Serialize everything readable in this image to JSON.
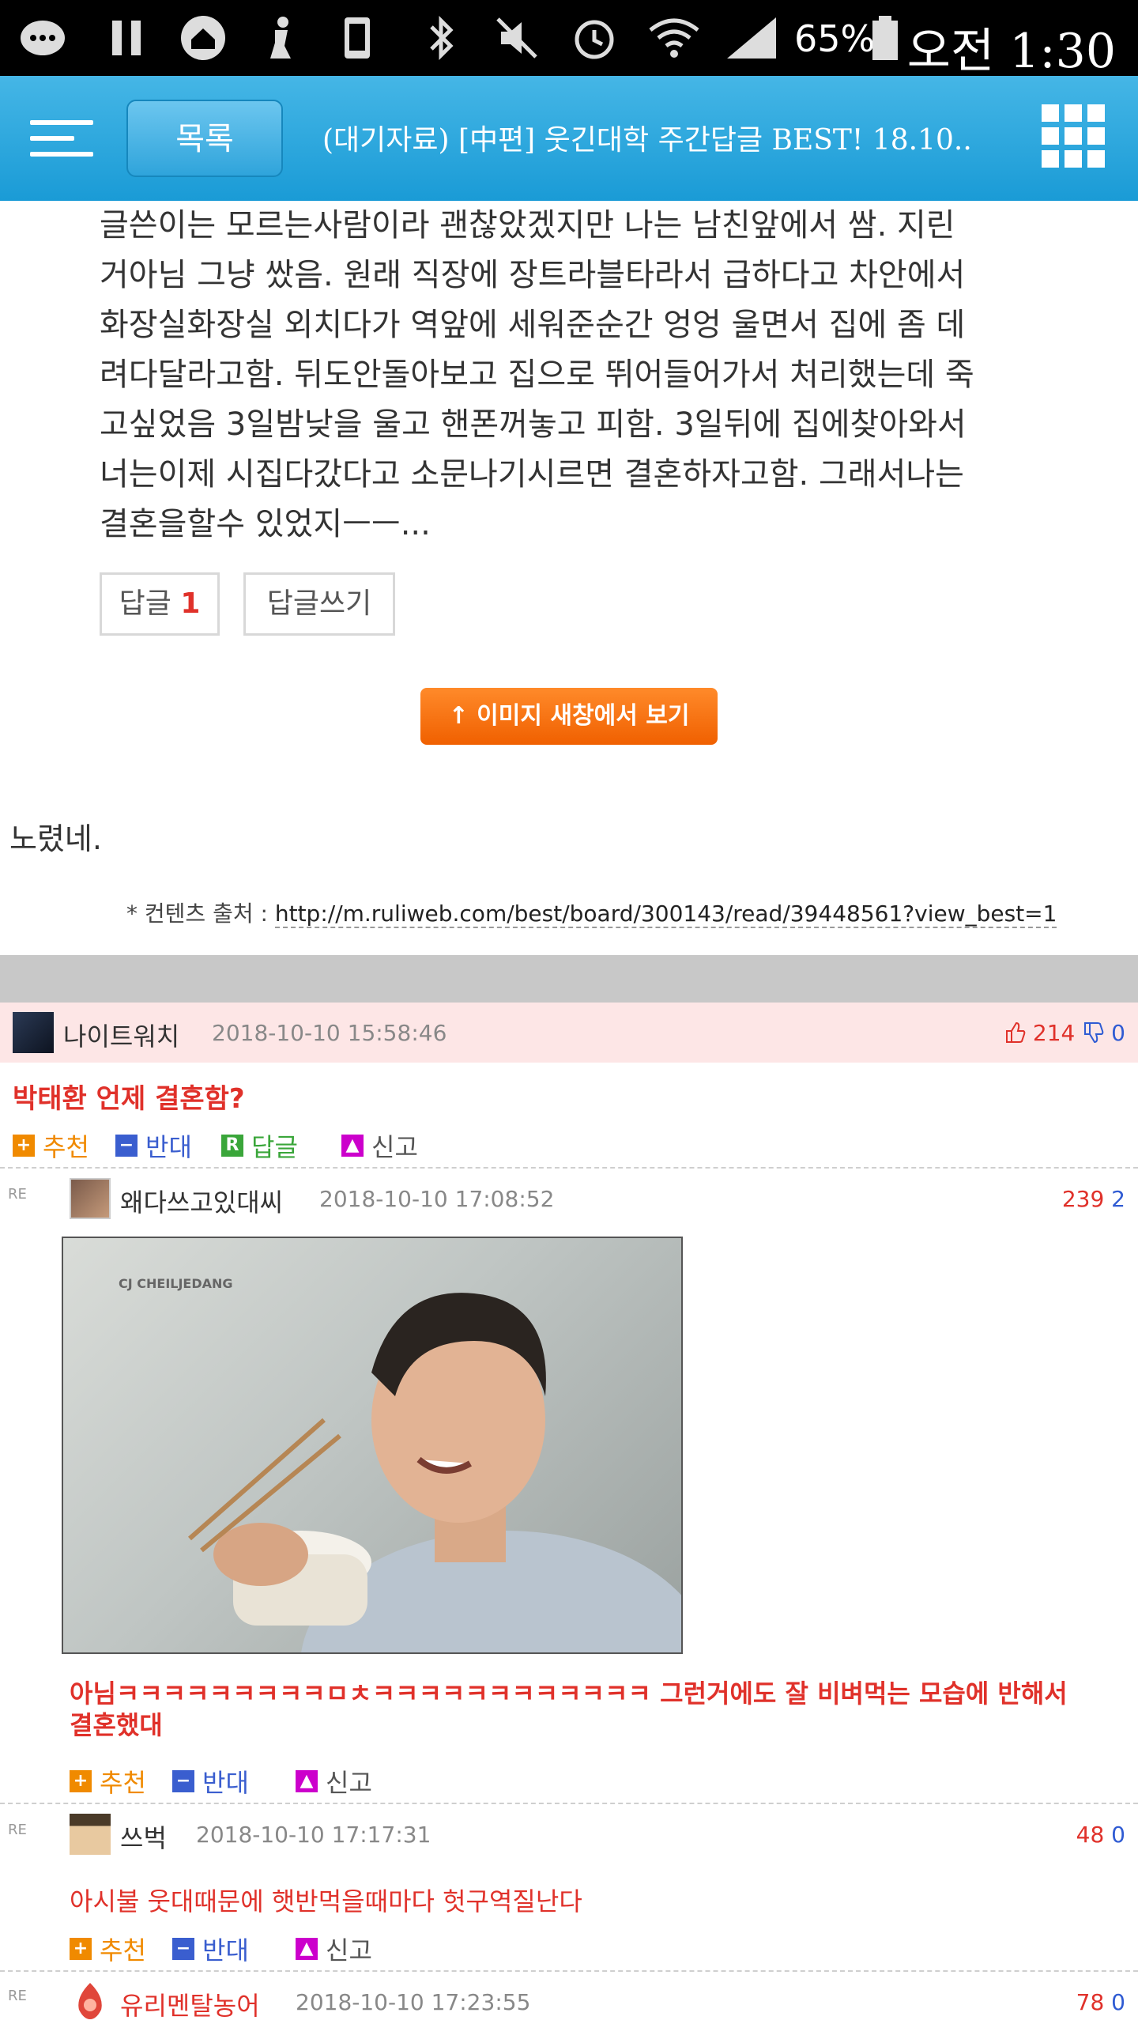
{
  "status_bar": {
    "battery": "65%",
    "time": "오전 1:30"
  },
  "top_bar": {
    "list_button": "목록",
    "title": "(대기자료) [中편] 웃긴대학 주간답글 BEST! 18.10..."
  },
  "article": {
    "lines": [
      "글쓴이는 모르는사람이라 괜찮았겠지만 나는 남친앞에서 쌈. 지린",
      "거아님 그냥 쌌음. 원래 직장에 장트라블타라서 급하다고 차안에서",
      "화장실화장실 외치다가 역앞에 세워준순간 엉엉 울면서 집에 좀 데",
      "려다달라고함. 뒤도안돌아보고 집으로 뛰어들어가서 처리했는데 죽",
      "고싶었음 3일밤낮을 울고 핸폰꺼놓고 피함. 3일뒤에 집에찾아와서",
      "너는이제 시집다갔다고 소문나기시르면 결혼하자고함. 그래서나는",
      "결혼을할수 있었지ㅡㅡ..."
    ],
    "reply_label": "답글",
    "reply_count": "1",
    "write_reply": "답글쓰기"
  },
  "image_window_button": "↑ 이미지 새창에서 보기",
  "body_comment": "노렸네.",
  "source": {
    "label": "* 컨텐츠 출처 : ",
    "url": "http://m.ruliweb.com/best/board/300143/read/39448561?view_best=1"
  },
  "actions": {
    "recommend": "추천",
    "oppose": "반대",
    "reply": "답글",
    "report": "신고"
  },
  "comments": [
    {
      "nick": "나이트워치",
      "date": "2018-10-10 15:58:46",
      "up": "214",
      "down": "0",
      "body": "박태환 언제 결혼함?"
    },
    {
      "re": "RE",
      "nick": "왜다쓰고있대씨",
      "date": "2018-10-10 17:08:52",
      "up": "239",
      "down": "2",
      "image_logo": "CJ CHEILJEDANG",
      "body_lines": [
        "아님ㅋㅋㅋㅋㅋㅋㅋㅋㅋㅁㅊㅋㅋㅋㅋㅋㅋㅋㅋㅋㅋㅋㅋ 그런거에도 잘 비벼먹는 모습에 반해서",
        "결혼했대"
      ]
    },
    {
      "re": "RE",
      "nick": "쓰벅",
      "date": "2018-10-10 17:17:31",
      "up": "48",
      "down": "0",
      "body": "아시불 웃대때문에 햇반먹을때마다 헛구역질난다"
    },
    {
      "re": "RE",
      "nick": "유리멘탈농어",
      "date": "2018-10-10 17:23:55",
      "up": "78",
      "down": "0"
    }
  ],
  "colors": {
    "topbar": "#1a9bd6",
    "accent_orange": "#f06000",
    "up_red": "#e0312a",
    "down_blue": "#2f5bd3"
  }
}
